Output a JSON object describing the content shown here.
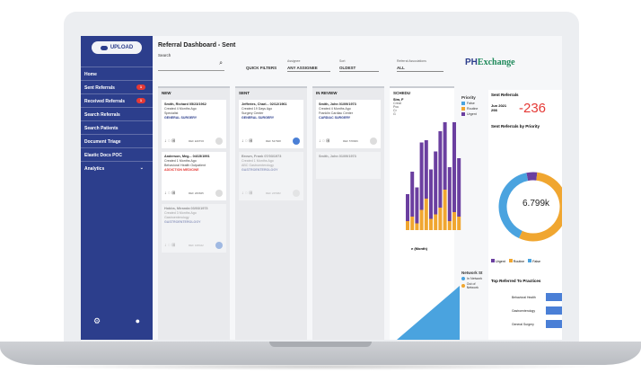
{
  "sidebar": {
    "upload_label": "UPLOAD",
    "items": [
      {
        "label": "Home"
      },
      {
        "label": "Sent Referrals",
        "badge": "1"
      },
      {
        "label": "Received Referrals",
        "badge": "1"
      },
      {
        "label": "Search Referrals"
      },
      {
        "label": "Search Patients"
      },
      {
        "label": "Document Triage"
      },
      {
        "label": "Elastic Docs POC"
      },
      {
        "label": "Analytics"
      }
    ]
  },
  "header": {
    "title": "Referral Dashboard - Sent",
    "search_label": "Search",
    "quick_filters": "QUICK FILTERS",
    "assignee_label": "Assignee",
    "assignee_value": "ANY ASSIGNEE",
    "sort_label": "Sort",
    "sort_value": "OLDEST",
    "assoc_label": "Referral Associations",
    "assoc_value": "ALL"
  },
  "logo": {
    "prefix": "PH",
    "name": "Exchange"
  },
  "columns": [
    {
      "title": "NEW",
      "cards": [
        {
          "name": "Smith, Richard   05/23/1962",
          "line1": "Created 4 Months Ago",
          "line2": "Specialist",
          "spec": "GENERAL SURGERY",
          "spec_color": "#2c3e8c",
          "ref": "REF EDIT06"
        },
        {
          "name": "Anderson, Meg...  04/15/1991",
          "line1": "Created 1 Months Ago",
          "line2": "Behavioral Health Outpatient",
          "spec": "ADDICTION MEDICINE",
          "spec_color": "#e53935",
          "ref": "REF 206845"
        },
        {
          "name": "Hobbs, Miranda   03/03/1973",
          "line1": "Created 3 Months Ago",
          "line2": "Gastroenterology",
          "spec": "GASTROENTEROLOGY",
          "spec_color": "#2c3e8c",
          "ref": "REF 108442",
          "faded": true
        }
      ]
    },
    {
      "title": "SENT",
      "cards": [
        {
          "name": "Jefferies, Charl... 02/12/1961",
          "line1": "Created 19 Days Ago",
          "line2": "Surgery Center",
          "spec": "GENERAL SURGERY",
          "spec_color": "#2c3e8c",
          "ref": "REF 547668"
        },
        {
          "name": "Brown, Frank     07/03/1973",
          "line1": "Created 1 Months Ago",
          "line2": "ABC Gastroenterology",
          "spec": "GASTROENTEROLOGY",
          "spec_color": "#2c3e8c",
          "ref": "REF 225682",
          "faded": true
        }
      ]
    },
    {
      "title": "IN REVIEW",
      "cards": [
        {
          "name": "Smith, John      01/09/1973",
          "line1": "Created 4 Months Ago",
          "line2": "Franklin Cardiac Center",
          "spec": "CARDIAC SURGERY",
          "spec_color": "#2c3e8c",
          "ref": "REF 578906"
        },
        {
          "name": "Smith, John      01/09/1973",
          "line1": "",
          "line2": "",
          "spec": "",
          "spec_color": "#2c3e8c",
          "ref": "",
          "faded": true
        }
      ]
    }
  ],
  "chart_panel": {
    "schedule_title": "SCHEDU",
    "schedule_name": "Sim, F",
    "schedule_lines": [
      "Creat",
      "Poc",
      "Cr",
      "G"
    ],
    "month_caption": "e (Month)",
    "network_title": "Network St",
    "network_legend": [
      {
        "label": "In Network",
        "color": "#4aa3df"
      },
      {
        "label": "Out of Network",
        "color": "#f0a630"
      }
    ]
  },
  "right_panel": {
    "title": "Sent Referrals",
    "period": "Jun 2021",
    "sub": "298",
    "delta": "-236",
    "priority_title": "Sent Referrals by Priority",
    "donut_value": "6.799k",
    "top_title": "Top Referred To Practices",
    "practices": [
      "Behavioral Health",
      "Gastroenterology",
      "General Surgery"
    ]
  },
  "colors": {
    "sidebar": "#2c3e8c",
    "urgent": "#6b3fa0",
    "routine": "#f0a630",
    "false": "#4aa3df",
    "delta": "#e53935"
  },
  "chart_data": {
    "type": "bar",
    "title": "",
    "legend_title": "Priority",
    "series": [
      {
        "name": "False",
        "values": [
          0,
          0,
          0,
          0,
          0,
          0,
          0,
          0,
          0,
          0,
          0,
          0
        ]
      },
      {
        "name": "Routine",
        "values": [
          4,
          6,
          3,
          9,
          14,
          5,
          7,
          10,
          18,
          4,
          8,
          6
        ]
      },
      {
        "name": "Urgent",
        "values": [
          12,
          20,
          16,
          30,
          26,
          22,
          28,
          34,
          30,
          24,
          40,
          26
        ]
      }
    ],
    "series_colors": [
      "#4aa3df",
      "#f0a630",
      "#6b3fa0"
    ],
    "donut": [
      {
        "name": "Urgent",
        "value": 5
      },
      {
        "name": "Routine",
        "value": 55
      },
      {
        "name": "False",
        "value": 40
      }
    ]
  }
}
